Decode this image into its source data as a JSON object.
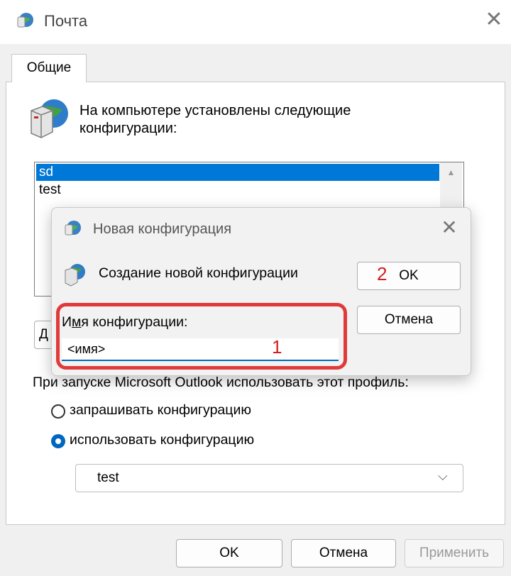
{
  "window": {
    "title": "Почта",
    "close_glyph": "✕",
    "icon": "mail-globe-icon"
  },
  "tabs": [
    {
      "label": "Общие",
      "active": true
    }
  ],
  "general": {
    "intro_icon": "server-globe-icon",
    "intro_text": "На компьютере установлены следующие конфигурации:",
    "profiles": [
      "sd",
      "test"
    ],
    "selected_profile_index": 0,
    "add_button_label": "Д",
    "startup_label": "При запуске Microsoft Outlook использовать этот профиль:",
    "radio_options": [
      {
        "label": "запрашивать конфигурацию",
        "checked": false
      },
      {
        "label": "использовать конфигурацию",
        "checked": true
      }
    ],
    "startup_profile_value": "test",
    "chevron_glyph": "⌵"
  },
  "footer": {
    "ok_label": "OK",
    "cancel_label": "Отмена",
    "apply_label": "Применить",
    "apply_enabled": false
  },
  "dialog": {
    "title": "Новая конфигурация",
    "close_glyph": "✕",
    "subtitle": "Создание новой конфигурации",
    "ok_label": "OK",
    "cancel_label": "Отмена",
    "name_label_prefix": "И",
    "name_label_accel": "м",
    "name_label_rest": "я конфигурации:",
    "name_value": "<имя>"
  },
  "annotations": {
    "marker_1": "1",
    "marker_2": "2",
    "highlight_color": "#e03a3a"
  },
  "colors": {
    "selection": "#0078d7",
    "accent": "#0067c0"
  }
}
